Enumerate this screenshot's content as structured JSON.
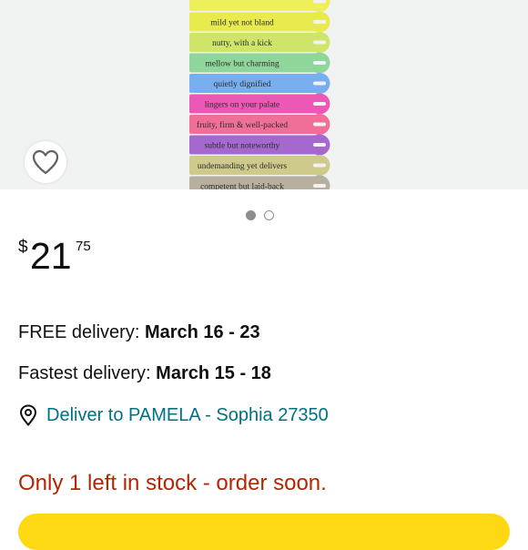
{
  "product_image": {
    "tags": [
      {
        "text": "",
        "color": "#eef05a"
      },
      {
        "text": "mild yet not bland",
        "color": "#e8ea4e"
      },
      {
        "text": "nutty, with a kick",
        "color": "#cfe56a"
      },
      {
        "text": "mellow but charming",
        "color": "#8fd69a"
      },
      {
        "text": "quietly dignified",
        "color": "#76aef0"
      },
      {
        "text": "lingers on your palate",
        "color": "#ec58b6"
      },
      {
        "text": "fruity, firm & well-packed",
        "color": "#f06f98"
      },
      {
        "text": "subtle but noteworthy",
        "color": "#a568cf"
      },
      {
        "text": "undemanding yet delivers",
        "color": "#cdca8c"
      },
      {
        "text": "competent but laid-back",
        "color": "#b7b09f"
      }
    ]
  },
  "gallery": {
    "active_index": 0,
    "count": 2
  },
  "price": {
    "symbol": "$",
    "whole": "21",
    "fraction": "75"
  },
  "delivery": {
    "free_label": "FREE delivery: ",
    "free_dates": "March 16 - 23",
    "fast_label": "Fastest delivery: ",
    "fast_dates": "March 15 - 18"
  },
  "location": {
    "text": "Deliver to PAMELA - Sophia 27350"
  },
  "stock": {
    "text": "Only 1 left in stock - order soon."
  },
  "colors": {
    "link": "#007185",
    "stock": "#b12704",
    "cart": "#ffd814"
  }
}
